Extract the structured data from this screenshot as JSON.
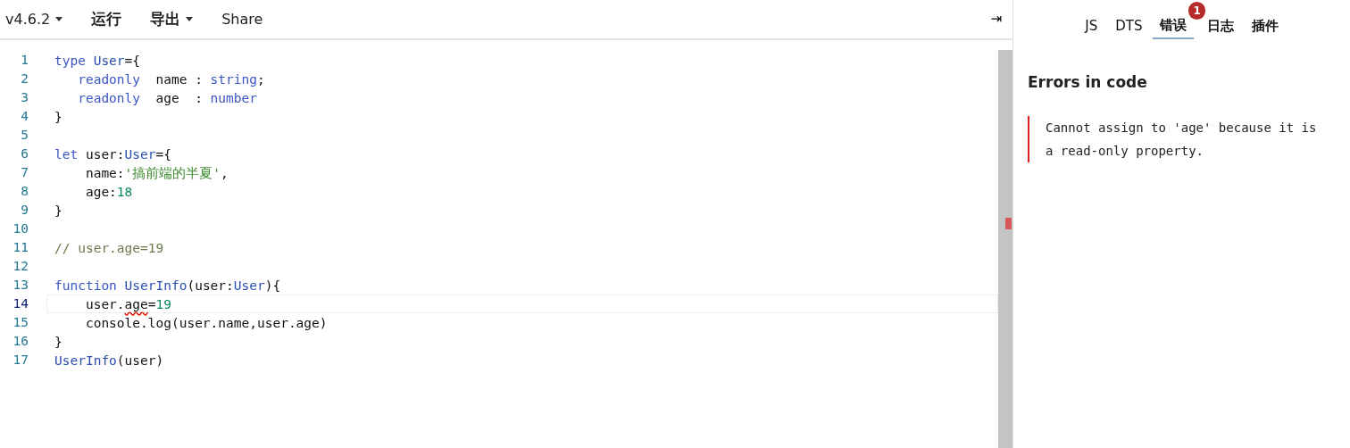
{
  "toolbar": {
    "items": [
      {
        "label": "v4.6.2",
        "dropdown": true
      },
      {
        "label": "运行",
        "dropdown": false
      },
      {
        "label": "导出",
        "dropdown": true
      },
      {
        "label": "Share",
        "dropdown": false
      }
    ],
    "collapse_glyph": "⇥"
  },
  "editor": {
    "lines": [
      {
        "number": "1",
        "current": false,
        "tokens": [
          {
            "text": "type ",
            "kind": "keyword"
          },
          {
            "text": "User",
            "kind": "type"
          },
          {
            "text": "={",
            "kind": "plain"
          }
        ]
      },
      {
        "number": "2",
        "current": false,
        "tokens": [
          {
            "text": "   readonly",
            "kind": "keyword"
          },
          {
            "text": "  name : ",
            "kind": "plain"
          },
          {
            "text": "string",
            "kind": "keyword"
          },
          {
            "text": ";",
            "kind": "plain"
          }
        ]
      },
      {
        "number": "3",
        "current": false,
        "tokens": [
          {
            "text": "   readonly",
            "kind": "keyword"
          },
          {
            "text": "  age  : ",
            "kind": "plain"
          },
          {
            "text": "number",
            "kind": "keyword"
          }
        ]
      },
      {
        "number": "4",
        "current": false,
        "tokens": [
          {
            "text": "}",
            "kind": "plain"
          }
        ]
      },
      {
        "number": "5",
        "current": false
      },
      {
        "number": "6",
        "current": false,
        "tokens": [
          {
            "text": "let",
            "kind": "keyword"
          },
          {
            "text": " user:",
            "kind": "plain"
          },
          {
            "text": "User",
            "kind": "type"
          },
          {
            "text": "={",
            "kind": "plain"
          }
        ]
      },
      {
        "number": "7",
        "current": false,
        "tokens": [
          {
            "text": "    name:",
            "kind": "plain"
          },
          {
            "text": "'搞前端的半夏'",
            "kind": "string"
          },
          {
            "text": ",",
            "kind": "plain"
          }
        ]
      },
      {
        "number": "8",
        "current": false,
        "tokens": [
          {
            "text": "    age:",
            "kind": "plain"
          },
          {
            "text": "18",
            "kind": "number"
          }
        ]
      },
      {
        "number": "9",
        "current": false,
        "tokens": [
          {
            "text": "}",
            "kind": "plain"
          }
        ]
      },
      {
        "number": "10",
        "current": false
      },
      {
        "number": "11",
        "current": false,
        "tokens": [
          {
            "text": "// user.age=19",
            "kind": "comment"
          }
        ]
      },
      {
        "number": "12",
        "current": false
      },
      {
        "number": "13",
        "current": false,
        "tokens": [
          {
            "text": "function ",
            "kind": "keyword"
          },
          {
            "text": "UserInfo",
            "kind": "type"
          },
          {
            "text": "(user:",
            "kind": "plain"
          },
          {
            "text": "User",
            "kind": "type"
          },
          {
            "text": "){",
            "kind": "plain"
          }
        ]
      },
      {
        "number": "14",
        "current": true,
        "tokens": [
          {
            "text": "    user.",
            "kind": "plain"
          },
          {
            "text": "age",
            "kind": "plain",
            "error": true
          },
          {
            "text": "=",
            "kind": "plain"
          },
          {
            "text": "19",
            "kind": "number"
          }
        ]
      },
      {
        "number": "15",
        "current": false,
        "tokens": [
          {
            "text": "    console.log(user.name,user.age)",
            "kind": "plain"
          }
        ]
      },
      {
        "number": "16",
        "current": false,
        "tokens": [
          {
            "text": "}",
            "kind": "plain"
          }
        ]
      },
      {
        "number": "17",
        "current": false,
        "tokens": [
          {
            "text": "UserInfo",
            "kind": "type"
          },
          {
            "text": "(user)",
            "kind": "plain"
          }
        ]
      }
    ]
  },
  "sidebar": {
    "tabs": [
      {
        "label": "JS",
        "selected": false
      },
      {
        "label": "DTS",
        "selected": false
      },
      {
        "label": "错误",
        "selected": true,
        "badge": "1"
      },
      {
        "label": "日志",
        "selected": false
      },
      {
        "label": "插件",
        "selected": false
      }
    ],
    "heading": "Errors in code",
    "errors": [
      "Cannot assign to 'age' because it is a read-only property."
    ]
  }
}
